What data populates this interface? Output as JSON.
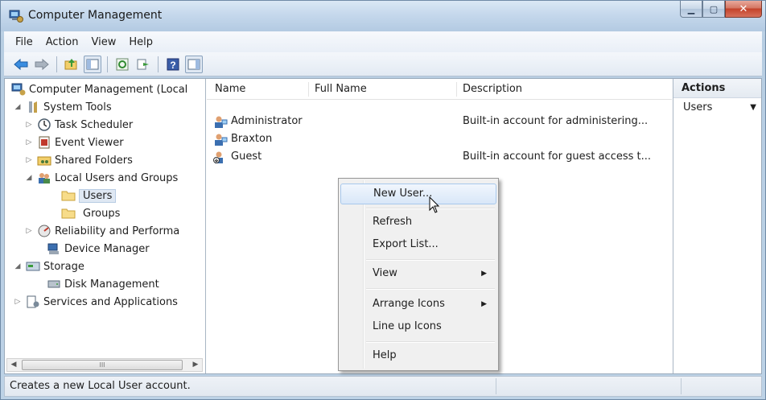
{
  "window": {
    "title": "Computer Management"
  },
  "menubar": [
    "File",
    "Action",
    "View",
    "Help"
  ],
  "tree": {
    "items": [
      {
        "label": "Computer Management (Local",
        "icon": "computer-management-icon"
      },
      {
        "label": "System Tools",
        "icon": "system-tools-icon"
      },
      {
        "label": "Task Scheduler",
        "icon": "clock-icon"
      },
      {
        "label": "Event Viewer",
        "icon": "event-viewer-icon"
      },
      {
        "label": "Shared Folders",
        "icon": "shared-folders-icon"
      },
      {
        "label": "Local Users and Groups",
        "icon": "users-group-icon"
      },
      {
        "label": "Users",
        "icon": "folder-icon"
      },
      {
        "label": "Groups",
        "icon": "folder-icon"
      },
      {
        "label": "Reliability and Performa",
        "icon": "performance-icon"
      },
      {
        "label": "Device Manager",
        "icon": "device-manager-icon"
      },
      {
        "label": "Storage",
        "icon": "storage-icon"
      },
      {
        "label": "Disk Management",
        "icon": "disk-icon"
      },
      {
        "label": "Services and Applications",
        "icon": "services-icon"
      }
    ]
  },
  "list": {
    "columns": [
      "Name",
      "Full Name",
      "Description"
    ],
    "rows": [
      {
        "name": "Administrator",
        "full_name": "",
        "description": "Built-in account for administering..."
      },
      {
        "name": "Braxton",
        "full_name": "",
        "description": ""
      },
      {
        "name": "Guest",
        "full_name": "",
        "description": "Built-in account for guest access t..."
      }
    ]
  },
  "actions": {
    "header": "Actions",
    "items": [
      "Users"
    ]
  },
  "context_menu": {
    "items": [
      "New User...",
      "Refresh",
      "Export List...",
      "View",
      "Arrange Icons",
      "Line up Icons",
      "Help"
    ],
    "hovered": "New User..."
  },
  "status": {
    "text": "Creates a new Local User account."
  },
  "scrollbar": {
    "grip": "III"
  }
}
